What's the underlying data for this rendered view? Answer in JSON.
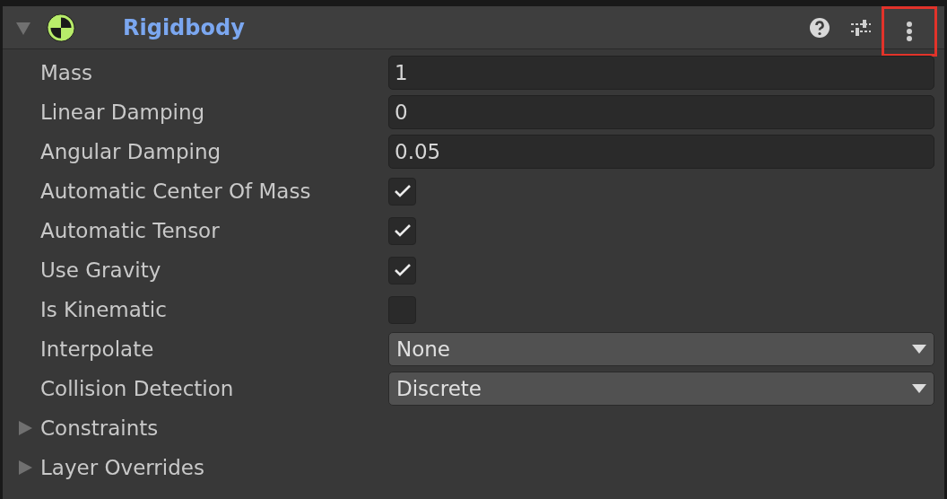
{
  "component": {
    "title": "Rigidbody",
    "expanded": true,
    "enabled": true,
    "toolbar": [
      {
        "kind": "help",
        "highlighted": false
      },
      {
        "kind": "presets",
        "highlighted": false
      },
      {
        "kind": "menu",
        "highlighted": true
      }
    ]
  },
  "properties": [
    {
      "kind": "number",
      "label": "Mass",
      "value": "1"
    },
    {
      "kind": "number",
      "label": "Linear Damping",
      "value": "0"
    },
    {
      "kind": "number",
      "label": "Angular Damping",
      "value": "0.05"
    },
    {
      "kind": "checkbox",
      "label": "Automatic Center Of Mass",
      "checked": true
    },
    {
      "kind": "checkbox",
      "label": "Automatic Tensor",
      "checked": true
    },
    {
      "kind": "checkbox",
      "label": "Use Gravity",
      "checked": true
    },
    {
      "kind": "checkbox",
      "label": "Is Kinematic",
      "checked": false
    },
    {
      "kind": "dropdown",
      "label": "Interpolate",
      "value": "None"
    },
    {
      "kind": "dropdown",
      "label": "Collision Detection",
      "value": "Discrete"
    },
    {
      "kind": "foldout",
      "label": "Constraints",
      "expanded": false
    },
    {
      "kind": "foldout",
      "label": "Layer Overrides",
      "expanded": false
    }
  ]
}
